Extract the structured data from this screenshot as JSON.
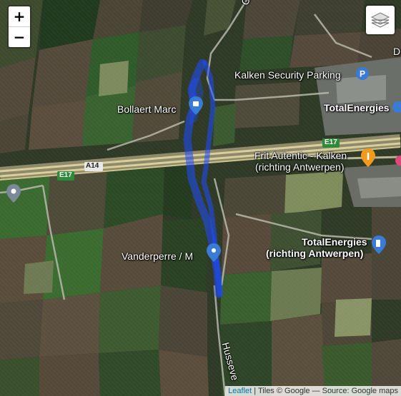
{
  "controls": {
    "zoom_in": "+",
    "zoom_out": "−"
  },
  "labels": {
    "bollaert": "Bollaert Marc",
    "kalken_parking": "Kalken Security Parking",
    "total1": "TotalEnergies",
    "frit_line1": "Frit Autentic - Kalken",
    "frit_line2": "(richting Antwerpen)",
    "total2_line1": "TotalEnergies",
    "total2_line2": "(richting Antwerpen)",
    "vanderperre": "Vanderperre / M",
    "husse": "Husseve",
    "coo": "Coo",
    "d_edge": "D",
    "a14": "A14",
    "e17_left": "E17",
    "e17_right": "E17"
  },
  "attribution": {
    "leaflet": "Leaflet",
    "rest": " | Tiles © Google — Source: Google maps"
  },
  "colors": {
    "route": "#1f4cff",
    "highway": "#d9cf9a",
    "poi_blue": "#3a7bd5",
    "poi_orange": "#f29a1f",
    "poi_grey": "#7b8a99"
  }
}
